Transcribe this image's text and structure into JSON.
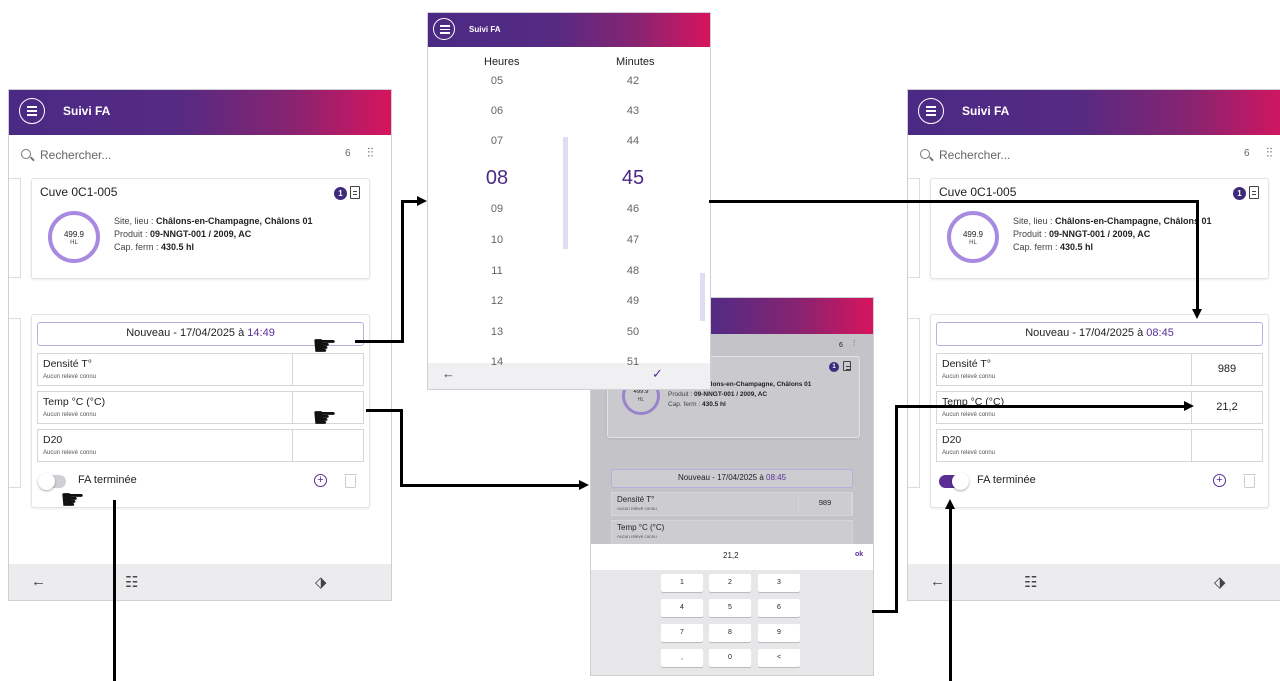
{
  "app_title": "Suivi FA",
  "search": {
    "placeholder": "Rechercher...",
    "count": "6",
    "filter_icon": "filter-sliders-icon"
  },
  "cuve": {
    "title": "Cuve 0C1-005",
    "badge": "1",
    "volume": "499.9",
    "unit": "HL",
    "site_label": "Site, lieu : ",
    "site_value": "Châlons-en-Champagne, Châlons 01",
    "produit_label": "Produit : ",
    "produit_value": "09-NNGT-001 / 2009, AC",
    "cap_label": "Cap. ferm : ",
    "cap_value": "430.5 hl",
    "ring_fill": 1.0
  },
  "screen1": {
    "nouveau_prefix": "Nouveau - 17/04/2025 à ",
    "nouveau_time": "14:49",
    "fa_done": false
  },
  "screen3": {
    "nouveau_prefix": "Nouveau - 17/04/2025 à ",
    "nouveau_time": "08:45",
    "fa_done": true
  },
  "measures": [
    {
      "label": "Densité T°",
      "sub": "Aucun relevé connu",
      "value_after": "989"
    },
    {
      "label": "Temp °C (°C)",
      "sub": "Aucun relevé connu",
      "value_after": "21,2"
    },
    {
      "label": "D20",
      "sub": "Aucun relevé connu",
      "value_after": ""
    }
  ],
  "fa_label": "FA terminée",
  "time_picker": {
    "title": "Suivi FA",
    "hours_label": "Heures",
    "minutes_label": "Minutes",
    "hours": [
      "05",
      "06",
      "07",
      "08",
      "09",
      "10",
      "11",
      "12",
      "13",
      "14"
    ],
    "minutes": [
      "42",
      "43",
      "44",
      "45",
      "46",
      "47",
      "48",
      "49",
      "50",
      "51"
    ],
    "selected_hour": "08",
    "selected_minute": "45",
    "back_icon": "arrow-left-icon",
    "confirm_icon": "check-icon"
  },
  "keypad": {
    "input_value": "21,2",
    "ok_label": "ok",
    "keys": [
      "1",
      "2",
      "3",
      "4",
      "5",
      "6",
      "7",
      "8",
      "9",
      ",",
      "0",
      "<"
    ],
    "first_value": "989",
    "nouveau_prefix": "Nouveau - 17/04/2025 à ",
    "nouveau_time": "08:45",
    "count": "6"
  },
  "footer_icons": [
    "arrow-left-icon",
    "checklist-icon",
    "tag-check-icon"
  ],
  "colors": {
    "accent": "#5a2e95",
    "header_start": "#4a2a85",
    "header_end": "#d8145e",
    "ring": "#a88be0"
  }
}
